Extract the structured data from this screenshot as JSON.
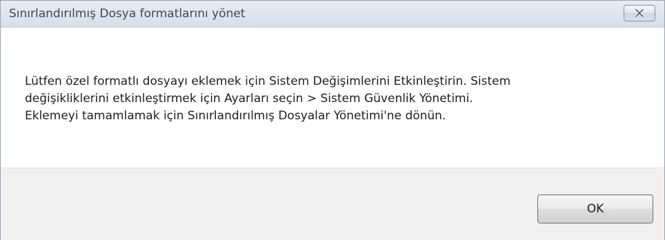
{
  "window": {
    "title": "Sınırlandırılmış Dosya formatlarını yönet",
    "close_icon": "close-icon"
  },
  "message": {
    "lines": [
      "Lütfen özel formatlı dosyayı eklemek için Sistem Değişimlerini Etkinleştirin. Sistem",
      "değişikliklerini etkinleştirmek için Ayarları seçin > Sistem Güvenlik Yönetimi.",
      "Eklemeyi tamamlamak için Sınırlandırılmış Dosyalar Yönetimi'ne dönün."
    ]
  },
  "buttons": {
    "ok_label": "OK"
  },
  "colors": {
    "titlebar": "#dde5ee",
    "footer": "#f0f0f0",
    "text": "#1e1e1e"
  }
}
